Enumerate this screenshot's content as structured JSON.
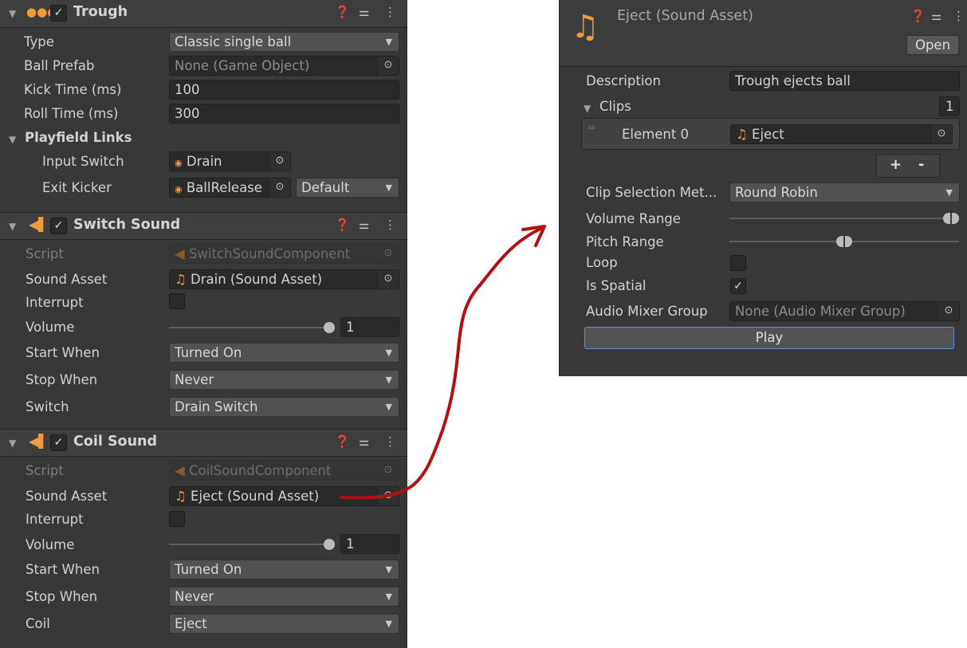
{
  "trough": {
    "title": "Trough",
    "type_label": "Type",
    "type_value": "Classic single ball",
    "ball_prefab_label": "Ball Prefab",
    "ball_prefab_value": "None (Game Object)",
    "kick_time_label": "Kick Time (ms)",
    "kick_time_value": "100",
    "roll_time_label": "Roll Time (ms)",
    "roll_time_value": "300",
    "playfield_links_label": "Playfield Links",
    "input_switch_label": "Input Switch",
    "input_switch_value": "Drain",
    "exit_kicker_label": "Exit Kicker",
    "exit_kicker_value": "BallRelease",
    "exit_kicker_mode": "Default"
  },
  "switch_sound": {
    "title": "Switch Sound",
    "script_label": "Script",
    "script_value": "SwitchSoundComponent",
    "sound_asset_label": "Sound Asset",
    "sound_asset_value": "Drain (Sound Asset)",
    "interrupt_label": "Interrupt",
    "volume_label": "Volume",
    "volume_value": "1",
    "start_when_label": "Start When",
    "start_when_value": "Turned On",
    "stop_when_label": "Stop When",
    "stop_when_value": "Never",
    "switch_label": "Switch",
    "switch_value": "Drain Switch"
  },
  "coil_sound": {
    "title": "Coil Sound",
    "script_label": "Script",
    "script_value": "CoilSoundComponent",
    "sound_asset_label": "Sound Asset",
    "sound_asset_value": "Eject (Sound Asset)",
    "interrupt_label": "Interrupt",
    "volume_label": "Volume",
    "volume_value": "1",
    "start_when_label": "Start When",
    "start_when_value": "Turned On",
    "stop_when_label": "Stop When",
    "stop_when_value": "Never",
    "coil_label": "Coil",
    "coil_value": "Eject"
  },
  "asset": {
    "title": "Eject (Sound Asset)",
    "open_label": "Open",
    "description_label": "Description",
    "description_value": "Trough ejects ball",
    "clips_label": "Clips",
    "clips_count": "1",
    "element_label": "Element 0",
    "element_value": "Eject",
    "add_label": "+",
    "remove_label": "-",
    "clip_selection_label": "Clip Selection Met...",
    "clip_selection_value": "Round Robin",
    "volume_range_label": "Volume Range",
    "pitch_range_label": "Pitch Range",
    "loop_label": "Loop",
    "is_spatial_label": "Is Spatial",
    "audio_mixer_label": "Audio Mixer Group",
    "audio_mixer_value": "None (Audio Mixer Group)",
    "play_label": "Play"
  },
  "colors": {
    "accent_orange": "#ef9a3c",
    "arrow_red": "#b40f0f",
    "panel_bg": "#383838"
  },
  "icons": [
    "trough-icon",
    "speaker-icon",
    "music-note-icon",
    "help-icon",
    "preset-icon",
    "kebab-menu-icon",
    "object-picker-icon",
    "dropdown-arrow-icon",
    "fold-arrow-icon",
    "checkmark-icon"
  ]
}
